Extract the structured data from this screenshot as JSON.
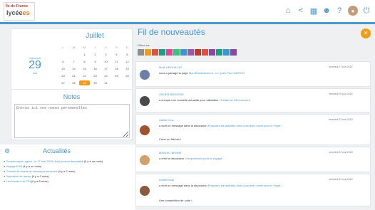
{
  "header": {
    "logo_region": "Île-de-France",
    "logo_lycee_a": "lycée",
    "logo_lycee_b": "es",
    "icons": [
      "home-icon",
      "share-icon",
      "apps-icon",
      "users-icon",
      "help-icon",
      "avatar",
      "power-icon"
    ]
  },
  "calendar": {
    "month": "Juillet",
    "weekday": "mercredi",
    "day": "29",
    "month_short": "Juil",
    "headers": [
      "L",
      "M",
      "M",
      "J",
      "V",
      "S",
      "D"
    ],
    "rows": [
      [
        "",
        "",
        "1",
        "2",
        "3",
        "4",
        "5"
      ],
      [
        "6",
        "7",
        "8",
        "9",
        "10",
        "11",
        "12"
      ],
      [
        "13",
        "14",
        "15",
        "16",
        "17",
        "18",
        "19"
      ],
      [
        "20",
        "21",
        "22",
        "23",
        "24",
        "25",
        "26"
      ],
      [
        "27",
        "28",
        "29",
        "30",
        "31",
        "",
        ""
      ]
    ],
    "today": "29",
    "accent": "#f39c12"
  },
  "notes": {
    "title": "Notes",
    "placeholder": "Entrez ici vos notes personnelles"
  },
  "news": {
    "title": "Actualités",
    "items": [
      {
        "text": "Communiqué urgent : le 17 mai 2015 demi-journée banalisée",
        "time": "(il y a un mois)"
      },
      {
        "text": "Voyage EVN",
        "time": "(il y a un mois)"
      },
      {
        "text": "Conseil de classe du deuxième trimestre",
        "time": "(il y a 2 mois)"
      },
      {
        "text": "Spectacle de danse",
        "time": "(il y a 2 mois)"
      },
      {
        "text": "Les travaux du CDI",
        "time": "(il y a 5 mois)"
      }
    ]
  },
  "feed": {
    "title": "Fil de nouveautés",
    "filter_label": "Filtrer sur",
    "filter_colors": [
      "#8e8e8e",
      "#f39c12",
      "#e74c3c",
      "#16a085",
      "#e84393",
      "#2ecc71",
      "#3498db",
      "#9b59b6",
      "#c0392b",
      "#e74c3c",
      "#8e44ad",
      "#16a085",
      "#3498db",
      "#8e44ad"
    ],
    "posts": [
      {
        "author": "Mme DROUILLAC",
        "action": "vous a partagé la page ",
        "link": "Mon Établissement - Le lycée Paul MARTIN",
        "date": "vendredi 27 juin 2015",
        "body": "",
        "avatar_color": "#6b7fa8"
      },
      {
        "author": "XAVIER BROUSSE",
        "action": "a envoyé une nouvelle actualité pour validation : ",
        "link": "Refaie du 24 novembre",
        "date": "vendredi 26 juin 2015",
        "body": "",
        "avatar_color": "#4a4a4a"
      },
      {
        "author": "Adélie Cruz",
        "action": "a écrit un message dans la discussion ",
        "link": "Proposez les activités dont vous avez envie pour le Foyer !",
        "date": "vendredi 22 mai 2015",
        "body": "Créer un fab lab !",
        "avatar_color": "#a0522d"
      },
      {
        "author": "MANUEL BENNE",
        "action": "a créé la discussion ",
        "link": "Vos questions pour le voyage",
        "date": "vendredi 22 mai 2015",
        "body": "",
        "avatar_color": "#d4a06a"
      },
      {
        "author": "Amélie Diaz",
        "action": "a écrit un message dans la discussion ",
        "link": "Proposez les activités dont vous avez envie pour le Foyer !",
        "date": "vendredi 22 mai 2015",
        "body": "Une compétition de code !",
        "avatar_color": "#8b5a3c"
      }
    ]
  }
}
